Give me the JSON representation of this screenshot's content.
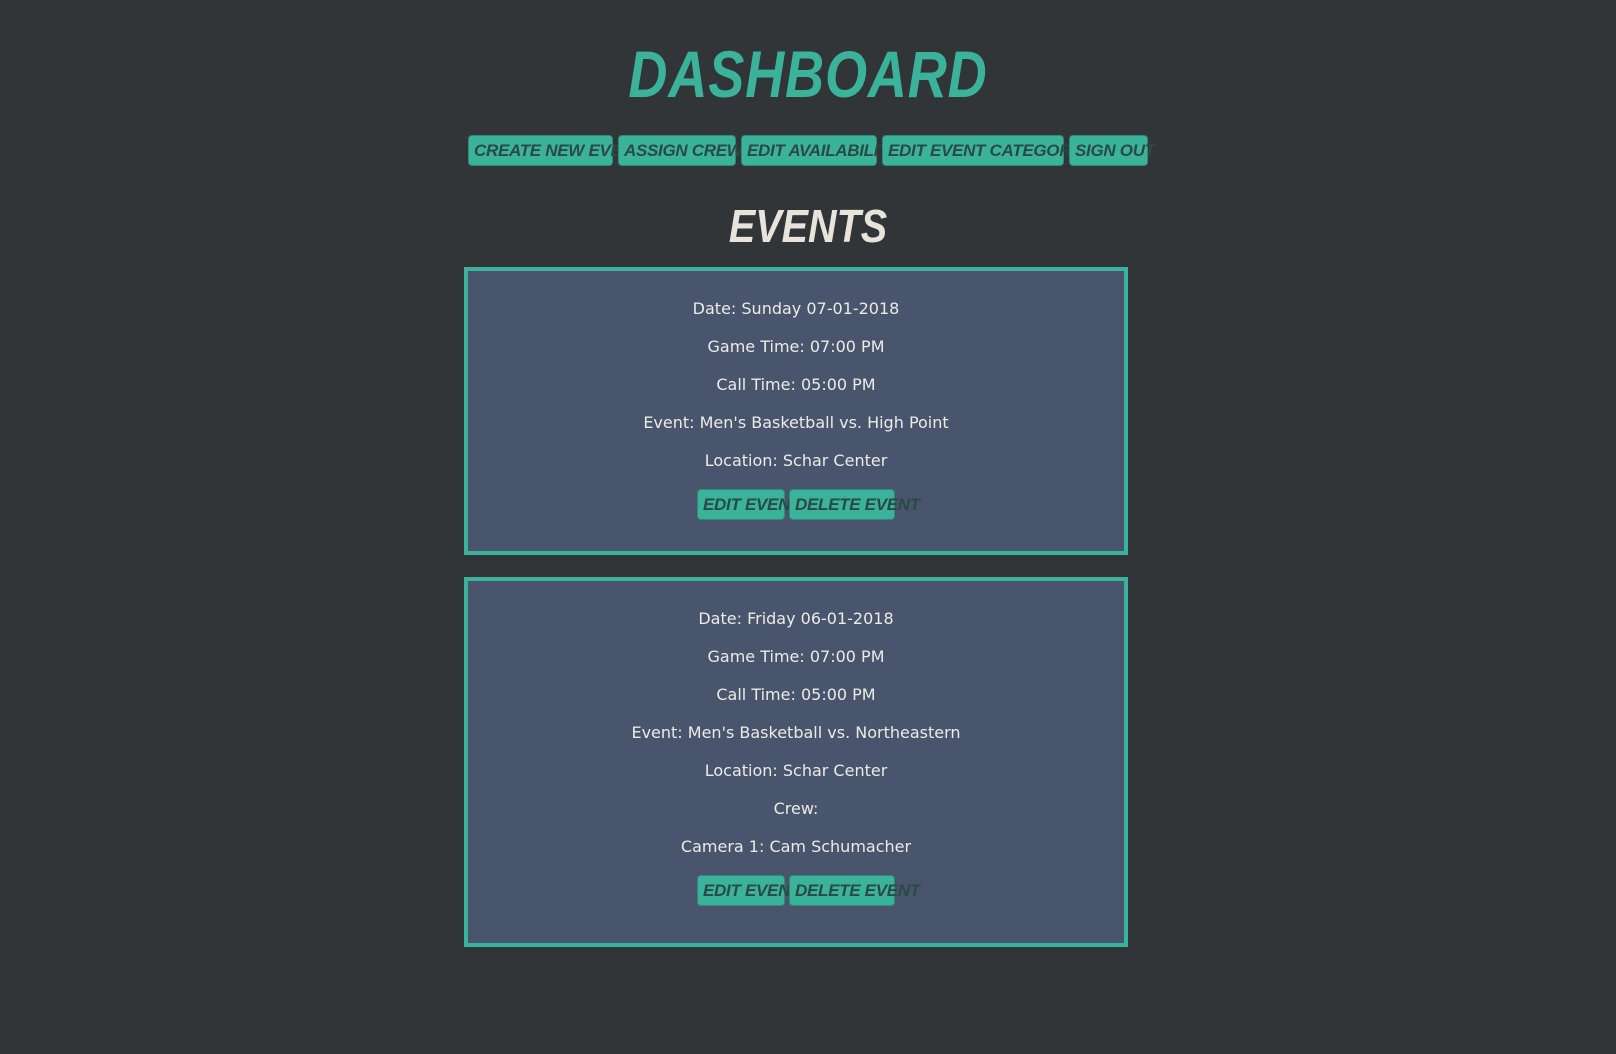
{
  "header": {
    "title": "DASHBOARD"
  },
  "nav": {
    "create_new_event": "CREATE NEW EVENT",
    "assign_crews": "ASSIGN CREWS",
    "edit_availability": "EDIT AVAILABILITY",
    "edit_event_categories": "EDIT EVENT CATEGORIES",
    "sign_out": "SIGN OUT"
  },
  "events_section": {
    "title": "EVENTS",
    "events": [
      {
        "date": "Date: Sunday 07-01-2018",
        "game_time": "Game Time: 07:00 PM",
        "call_time": "Call Time: 05:00 PM",
        "event": "Event: Men's Basketball vs. High Point",
        "location": "Location: Schar Center",
        "edit_label": "EDIT EVENT",
        "delete_label": "DELETE EVENT"
      },
      {
        "date": "Date: Friday 06-01-2018",
        "game_time": "Game Time: 07:00 PM",
        "call_time": "Call Time: 05:00 PM",
        "event": "Event: Men's Basketball vs. Northeastern",
        "location": "Location: Schar Center",
        "crew_label": "Crew:",
        "crew": [
          "Camera 1: Cam Schumacher"
        ],
        "edit_label": "EDIT EVENT",
        "delete_label": "DELETE EVENT"
      }
    ]
  },
  "colors": {
    "background": "#313538",
    "accent": "#3bb39b",
    "card_background": "#48556d",
    "heading_light": "#e8e4dc",
    "button_text": "#2a4a45"
  }
}
